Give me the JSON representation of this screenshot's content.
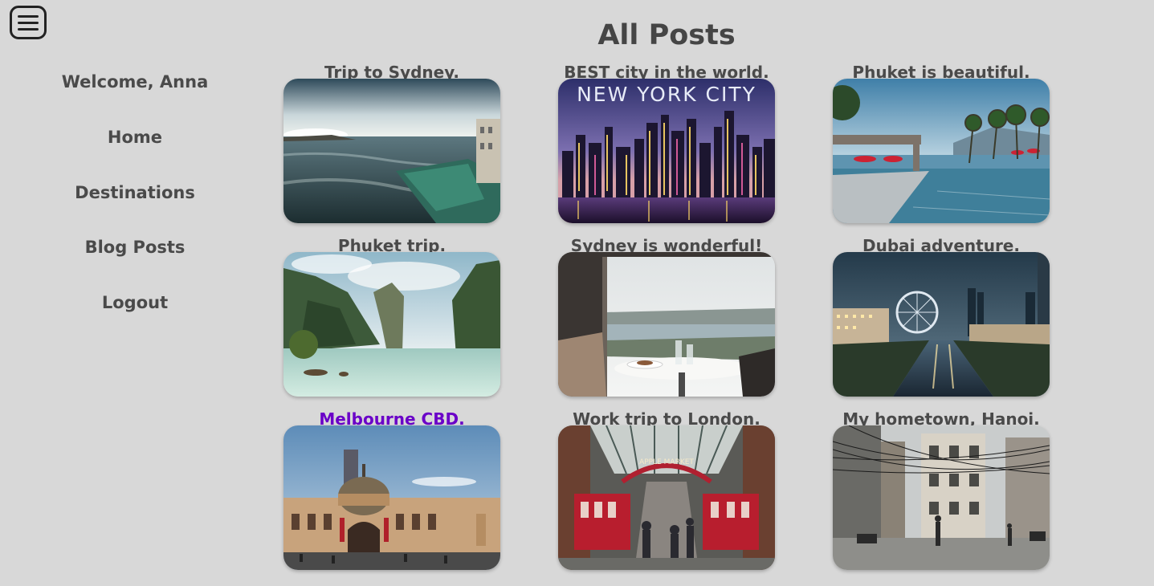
{
  "sidebar": {
    "items": [
      {
        "label": "Welcome, Anna"
      },
      {
        "label": "Home"
      },
      {
        "label": "Destinations"
      },
      {
        "label": "Blog Posts"
      },
      {
        "label": "Logout"
      }
    ]
  },
  "page": {
    "title": "All Posts"
  },
  "posts": [
    {
      "title": "Trip to Sydney."
    },
    {
      "title": "BEST city in the world.",
      "image_text": "NEW YORK CITY"
    },
    {
      "title": "Phuket is beautiful."
    },
    {
      "title": "Phuket trip."
    },
    {
      "title": "Sydney is wonderful!"
    },
    {
      "title": "Dubai adventure."
    },
    {
      "title": "Melbourne CBD.",
      "visited": true
    },
    {
      "title": "Work trip to London.",
      "image_text": "APPLE MARKET"
    },
    {
      "title": "My hometown, Hanoi."
    }
  ],
  "colors": {
    "background": "#d8d8d8",
    "text": "#4a4a4a",
    "visited_link": "#6a00c8"
  }
}
